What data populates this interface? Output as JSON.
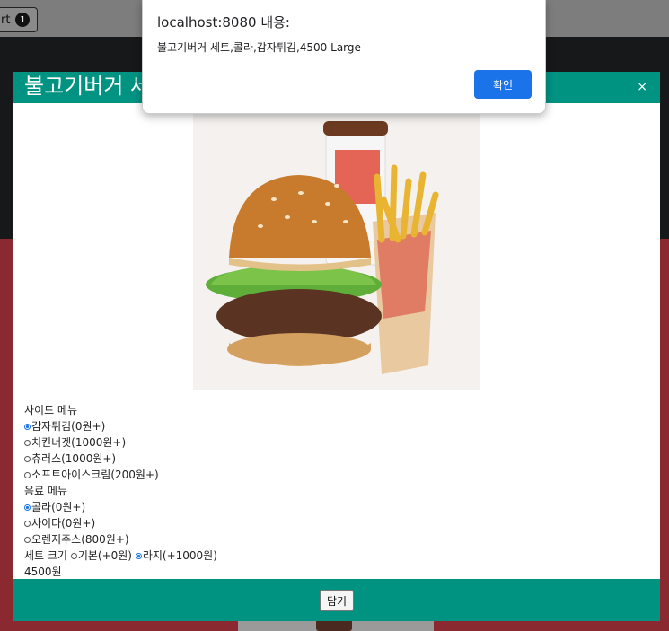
{
  "page": {
    "cart_button_label": "rt",
    "cart_count": "1"
  },
  "modal": {
    "title": "불고기버거 세트",
    "close_label": "×",
    "side_menu": {
      "heading": "사이드 메뉴",
      "options": [
        {
          "label": "감자튀김(0원+)",
          "selected": true
        },
        {
          "label": "치킨너겟(1000원+)",
          "selected": false
        },
        {
          "label": "츄러스(1000원+)",
          "selected": false
        },
        {
          "label": "소프트아이스크림(200원+)",
          "selected": false
        }
      ]
    },
    "drink_menu": {
      "heading": "음료 메뉴",
      "options": [
        {
          "label": "콜라(0원+)",
          "selected": true
        },
        {
          "label": "사이다(0원+)",
          "selected": false
        },
        {
          "label": "오렌지주스(800원+)",
          "selected": false
        }
      ]
    },
    "set_size": {
      "heading": "세트 크기",
      "options": [
        {
          "label": "기본(+0원)",
          "selected": false
        },
        {
          "label": "라지(+1000원)",
          "selected": true
        }
      ]
    },
    "price": "4500원",
    "add_button_label": "담기"
  },
  "alert": {
    "origin": "localhost:8080 내용:",
    "message": "불고기버거 세트,콜라,감자튀김,4500 Large",
    "ok_label": "확인",
    "ok_color": "#1a73e8"
  },
  "colors": {
    "modal_accent": "#009382",
    "page_red": "#8a2a30",
    "page_dark": "#17181a"
  }
}
